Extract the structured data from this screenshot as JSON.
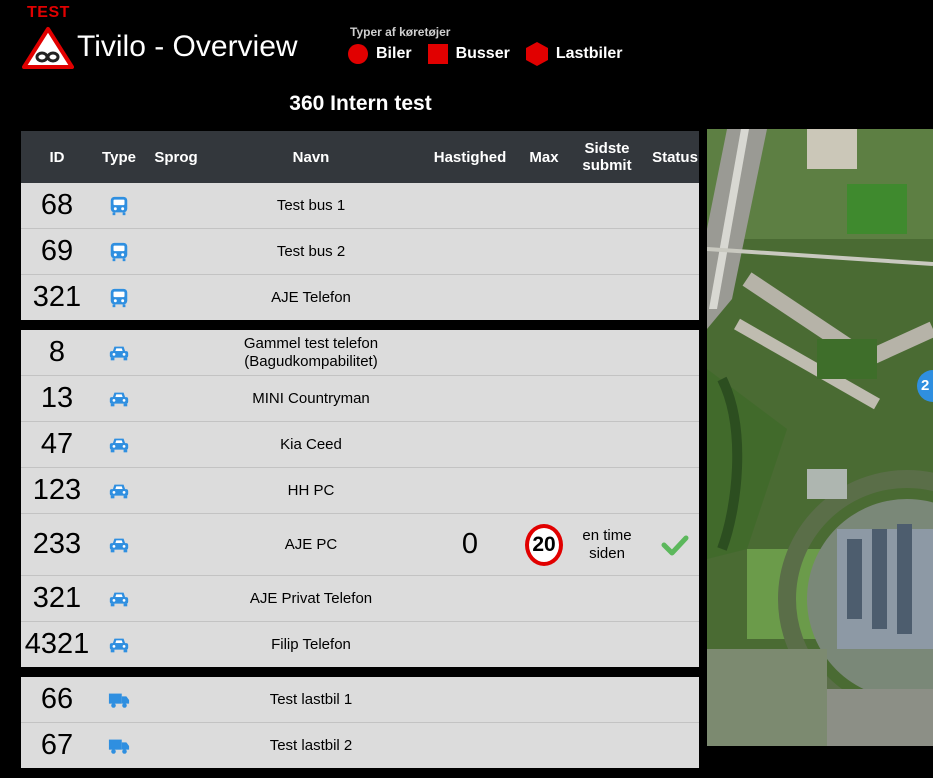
{
  "header": {
    "env_tag": "TEST",
    "title": "Tivilo - Overview",
    "legend_title": "Typer af køretøjer",
    "legend": [
      {
        "label": "Biler",
        "shape": "circle"
      },
      {
        "label": "Busser",
        "shape": "square"
      },
      {
        "label": "Lastbiler",
        "shape": "hexagon"
      }
    ],
    "accent_color": "#e10000"
  },
  "group_title": "360 Intern test",
  "table": {
    "columns": [
      "ID",
      "Type",
      "Sprog",
      "Navn",
      "Hastighed",
      "Max",
      "Sidste submit",
      "Status"
    ],
    "groups": [
      {
        "vehicle_type": "bus",
        "rows": [
          {
            "id": "68",
            "name": "Test bus 1"
          },
          {
            "id": "69",
            "name": "Test bus 2"
          },
          {
            "id": "321",
            "name": "AJE Telefon"
          }
        ]
      },
      {
        "vehicle_type": "car",
        "rows": [
          {
            "id": "8",
            "name": "Gammel test telefon (Bagudkompabilitet)"
          },
          {
            "id": "13",
            "name": "MINI Countryman"
          },
          {
            "id": "47",
            "name": "Kia Ceed"
          },
          {
            "id": "123",
            "name": "HH PC"
          },
          {
            "id": "233",
            "name": "AJE PC",
            "speed": "0",
            "max": "20",
            "last_submit": "en time siden",
            "status": "ok"
          },
          {
            "id": "321",
            "name": "AJE Privat Telefon"
          },
          {
            "id": "4321",
            "name": "Filip Telefon"
          }
        ]
      },
      {
        "vehicle_type": "truck",
        "rows": [
          {
            "id": "66",
            "name": "Test lastbil 1"
          },
          {
            "id": "67",
            "name": "Test lastbil 2"
          }
        ]
      }
    ]
  },
  "map": {
    "marker_label": "2"
  },
  "colors": {
    "icon_blue": "#2f8fe0",
    "status_green": "#5cb85c",
    "header_bg": "#33373c",
    "row_bg": "#dcdcdc"
  }
}
